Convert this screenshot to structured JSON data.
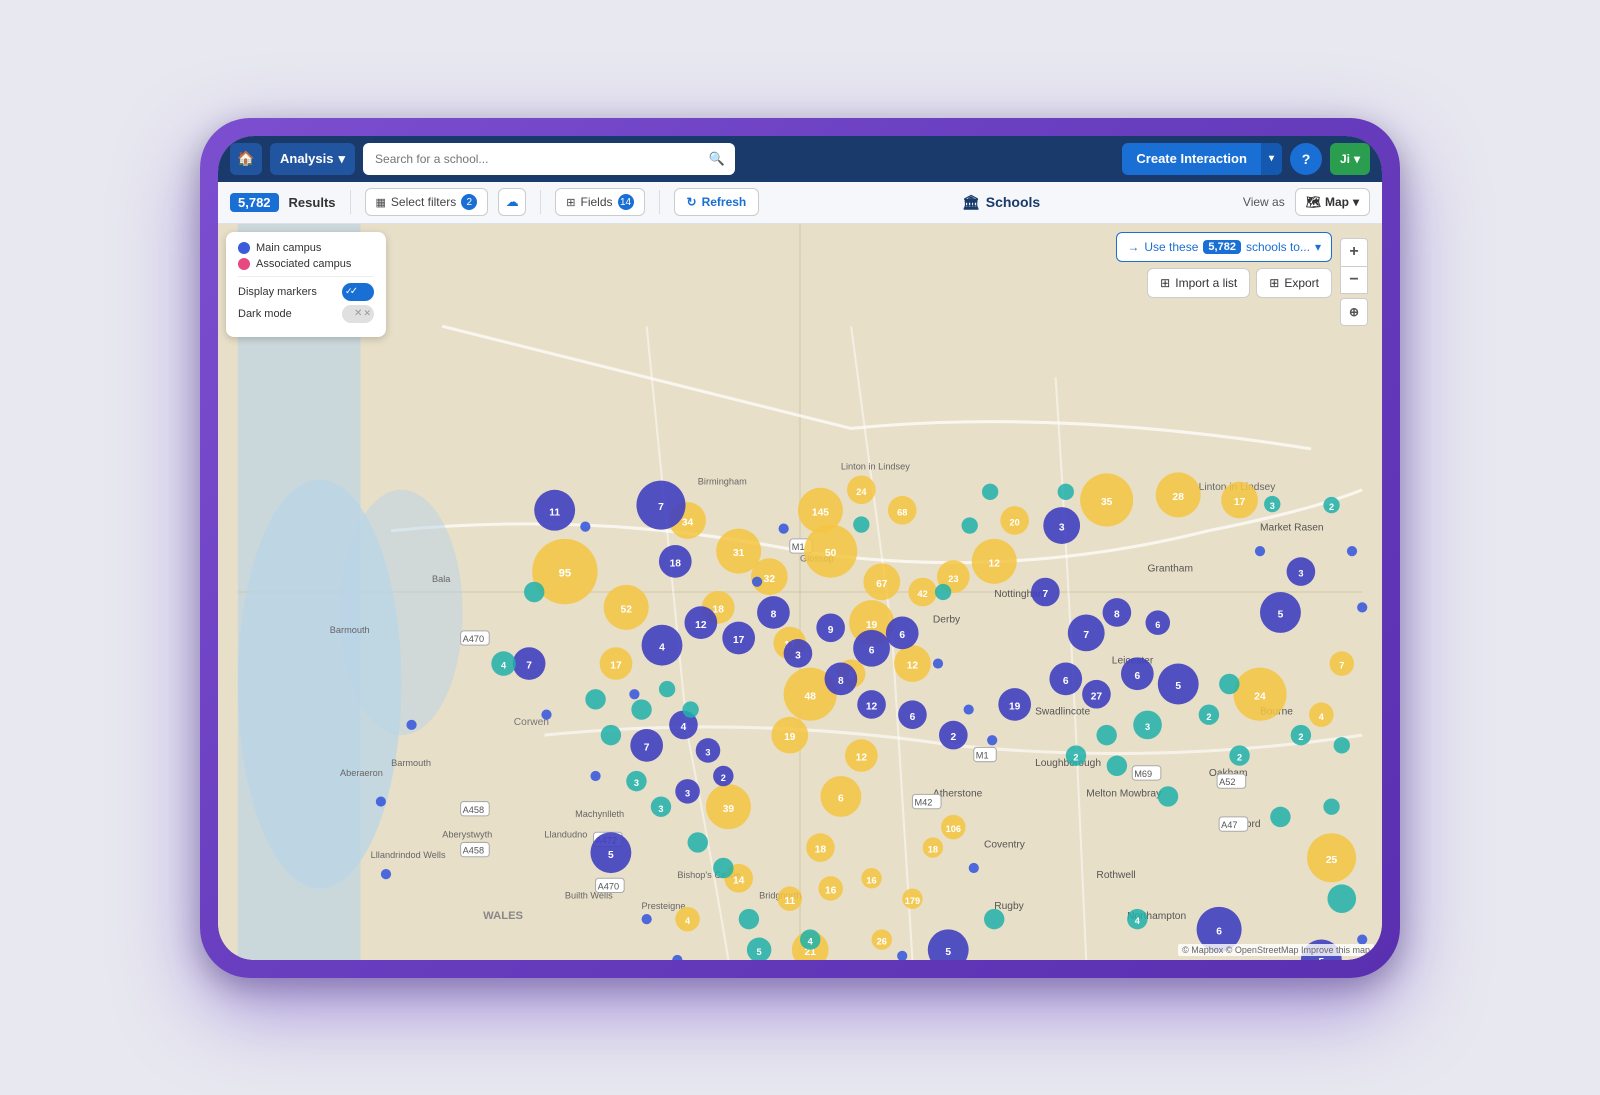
{
  "tablet": {
    "nav": {
      "home_icon": "🏠",
      "analysis_label": "Analysis",
      "search_placeholder": "Search for a school...",
      "create_interaction_label": "Create Interaction",
      "help_label": "?",
      "user_label": "Ji"
    },
    "toolbar": {
      "results_count": "5,782",
      "results_label": "Results",
      "select_filters_label": "Select filters",
      "filter_count": "2",
      "fields_label": "Fields",
      "fields_count": "14",
      "refresh_label": "Refresh",
      "page_title": "Schools",
      "view_as_label": "View as",
      "map_label": "Map",
      "use_these_label": "Use these",
      "schools_count": "5,782",
      "schools_to_label": "schools to...",
      "import_label": "Import a list",
      "export_label": "Export"
    },
    "legend": {
      "main_campus_label": "Main campus",
      "associated_campus_label": "Associated campus",
      "display_markers_label": "Display markers",
      "dark_mode_label": "Dark mode",
      "main_campus_color": "#3b5bdb",
      "associated_campus_color": "#e64980",
      "display_markers_on": true,
      "dark_mode_on": false
    },
    "map": {
      "attribution": "© Mapbox © OpenStreetMap  Improve this map"
    }
  }
}
